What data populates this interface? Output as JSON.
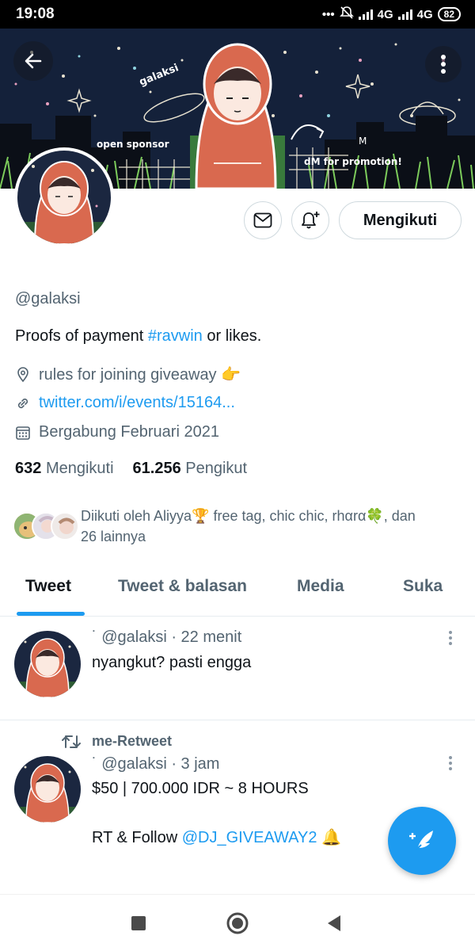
{
  "status_bar": {
    "time": "19:08",
    "network_1": "4G",
    "network_2": "4G",
    "battery": "82"
  },
  "banner": {
    "text_galaksi": "galaksi",
    "text_open_sponsor": "open sponsor",
    "text_dm_promotion": "dM for promotion!",
    "text_m": "M"
  },
  "actions": {
    "following_label": "Mengikuti"
  },
  "profile": {
    "handle": "@galaksi",
    "bio_prefix": "Proofs of payment ",
    "bio_hashtag": "#ravwin",
    "bio_suffix": " or likes.",
    "location": "rules for joining giveaway 👉",
    "website": "twitter.com/i/events/15164...",
    "joined": "Bergabung Februari 2021",
    "following_count": "632",
    "following_label": "Mengikuti",
    "followers_count": "61.256",
    "followers_label": "Pengikut",
    "followed_by_line1": "Diikuti oleh Aliyya🏆 free tag, chic chic, rhαrα🍀, dan",
    "followed_by_line2": "26 lainnya"
  },
  "tabs": [
    {
      "label": "Tweet",
      "active": true
    },
    {
      "label": "Tweet & balasan",
      "active": false
    },
    {
      "label": "Media",
      "active": false
    },
    {
      "label": "Suka",
      "active": false
    }
  ],
  "tweets": [
    {
      "head": "˙ @galaksi · 22 menit",
      "text": "nyangkut? pasti engga"
    },
    {
      "retweet_label": "me-Retweet",
      "head": "˙ @galaksi · 3 jam",
      "text_line1": "$50 | 700.000 IDR ~ 8 HOURS",
      "text_line2_prefix": "RT & Follow ",
      "text_line2_mention": "@DJ_GIVEAWAY2",
      "text_line2_suffix": " 🔔"
    }
  ],
  "colors": {
    "accent": "#1d9bf0",
    "secondary_text": "#536471",
    "banner_sky": "#14213a",
    "hoodie": "#d9694f"
  }
}
